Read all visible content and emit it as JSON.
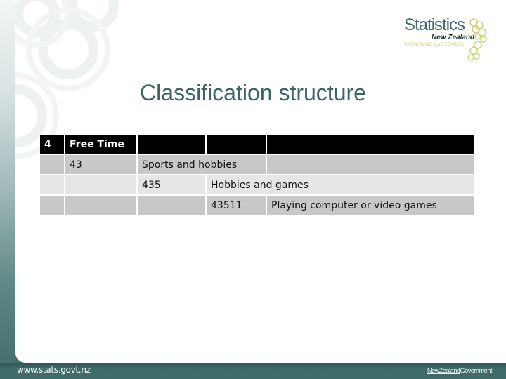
{
  "slide": {
    "title": "Classification structure",
    "brand": {
      "logo_main": "Statistics",
      "logo_sub": "New Zealand",
      "logo_maori": "TATAURANGA AOTEAROA"
    },
    "footer": {
      "url": "www.stats.govt.nz",
      "gov_prefix": "NewZealand",
      "gov_suffix": "Government"
    },
    "colors": {
      "accent": "#3f6b69",
      "title": "#3a6564",
      "header_bg": "#000000",
      "row_dark": "#c8c8c8",
      "row_light": "#e6e6e6",
      "logo_gold": "#c8c86a"
    }
  },
  "table": {
    "rows": [
      {
        "cells": [
          "4",
          "Free Time",
          "",
          "",
          ""
        ]
      },
      {
        "cells": [
          "",
          "43",
          "Sports and hobbies",
          "",
          ""
        ]
      },
      {
        "cells": [
          "",
          "",
          "435",
          "Hobbies and games",
          ""
        ]
      },
      {
        "cells": [
          "",
          "",
          "",
          "43511",
          "Playing computer or video games"
        ]
      }
    ]
  }
}
